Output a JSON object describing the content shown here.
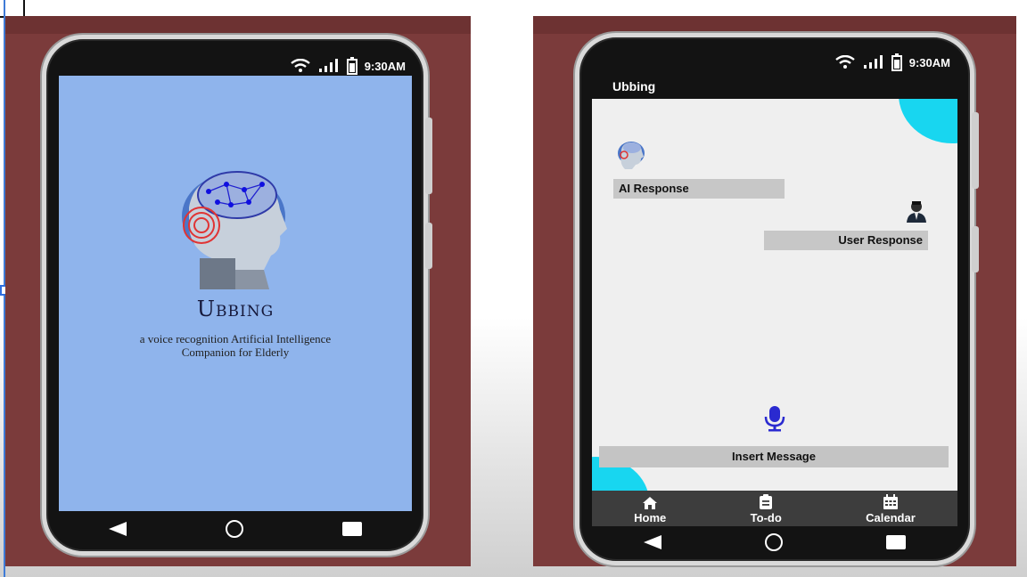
{
  "status_bar": {
    "time": "9:30AM",
    "wifi_icon": "wifi-icon",
    "signal_icon": "signal-icon",
    "battery_icon": "battery-icon"
  },
  "splash": {
    "logo_icon": "ai-head-brain-icon",
    "title": "Ubbing",
    "subtitle_line1": "a voice recognition Artificial Intelligence",
    "subtitle_line2": "Companion for Elderly"
  },
  "chat_app": {
    "app_title": "Ubbing",
    "ai_avatar_icon": "ai-head-icon",
    "ai_response": "AI Response",
    "user_avatar_icon": "user-icon",
    "user_response": "User Response",
    "mic_icon": "microphone-icon",
    "insert_message": "Insert Message",
    "tabs": [
      {
        "label": "Home",
        "icon": "home-icon"
      },
      {
        "label": "To-do",
        "icon": "todo-icon"
      },
      {
        "label": "Calendar",
        "icon": "calendar-icon"
      }
    ],
    "accent_color": "#18d6f0"
  },
  "navigation": {
    "back_icon": "back-icon",
    "home_icon": "home-circle-icon",
    "recents_icon": "recents-icon"
  },
  "colors": {
    "panel": "#7b3b3b",
    "splash_bg": "#8fb4ec",
    "chat_bg": "#efefef",
    "mic": "#2a2ad0"
  }
}
